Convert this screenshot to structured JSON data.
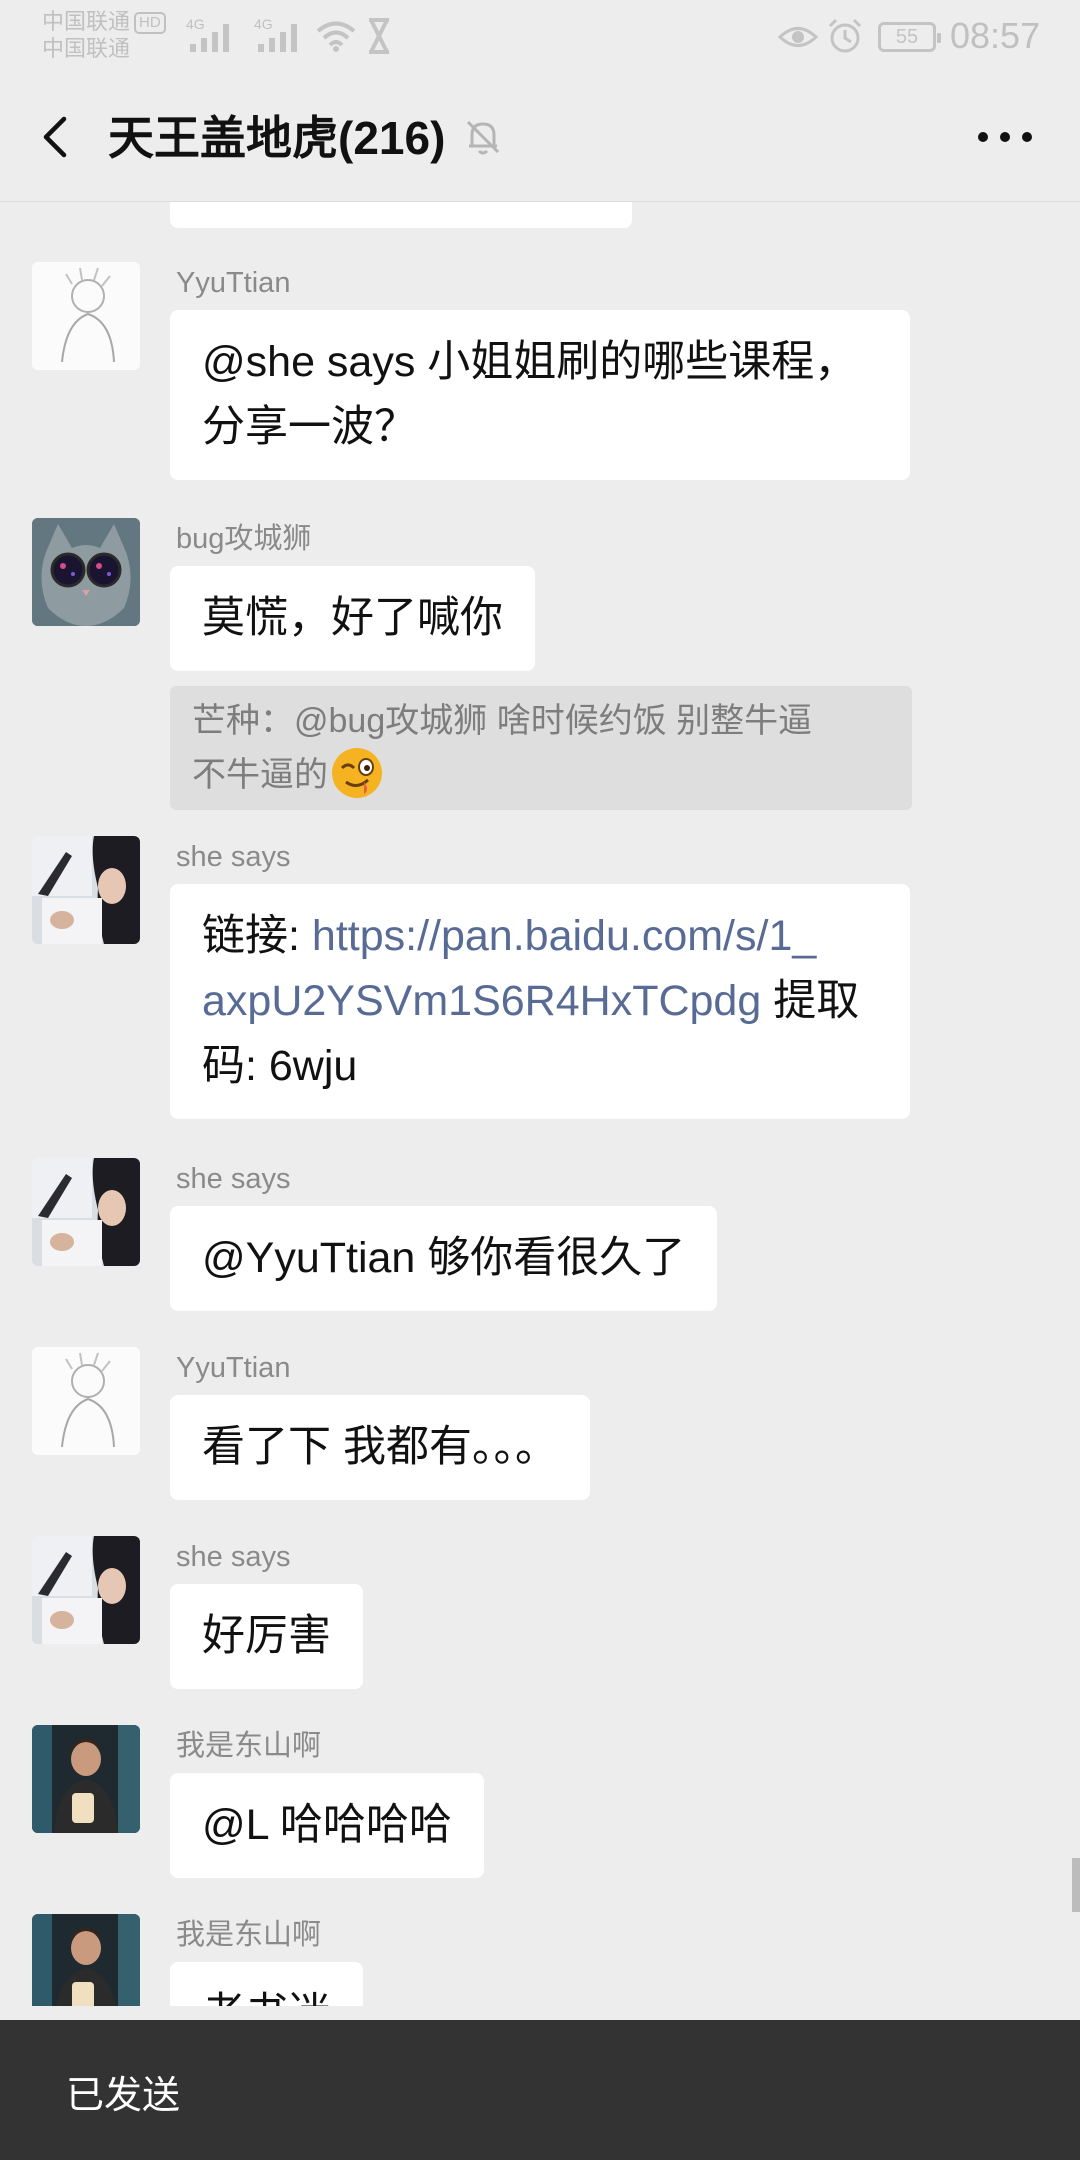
{
  "status_bar": {
    "carrier_line1": "中国联通",
    "carrier_badge": "HD",
    "carrier_line2": "中国联通",
    "signal_tag_1": "4G",
    "signal_tag_2": "4G",
    "battery": "55",
    "time": "08:57"
  },
  "header": {
    "title": "天王盖地虎(216)"
  },
  "messages": [
    {
      "sender": "YyuTtian",
      "line1": "@she says  小姐姐刷的哪些课程，",
      "line2": "分享一波？"
    },
    {
      "sender": "bug攻城狮",
      "text": "莫慌，好了喊你",
      "quote_line1": "芒种：@bug攻城狮 啥时候约饭 别整牛逼",
      "quote_line2": "不牛逼的"
    },
    {
      "sender": "she says",
      "label": "链接: ",
      "link_line1": "https://pan.baidu.com/s/1_",
      "link_line2": "axpU2YSVm1S6R4HxTCpdg",
      "after_link": " 提取",
      "line3": "码: 6wju"
    },
    {
      "sender": "she says",
      "text": "@YyuTtian  够你看很久了"
    },
    {
      "sender": "YyuTtian",
      "text": "看了下 我都有。。。"
    },
    {
      "sender": "she says",
      "text": "好厉害"
    },
    {
      "sender": "我是东山啊",
      "text": "@L  哈哈哈哈"
    },
    {
      "sender": "我是东山啊",
      "text": "老书迷"
    }
  ],
  "toast": {
    "label": "已发送"
  },
  "colors": {
    "background": "#ededed",
    "bubble": "#ffffff",
    "link": "#576b95",
    "toast": "#333333"
  }
}
